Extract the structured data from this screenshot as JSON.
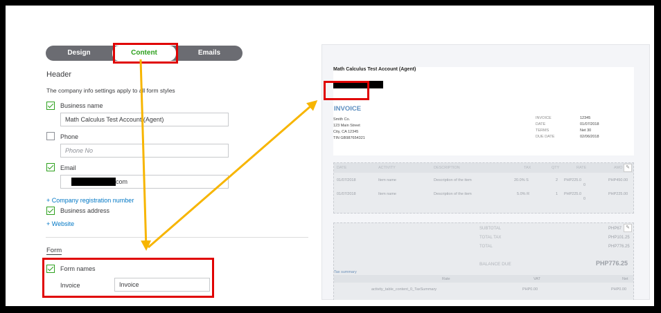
{
  "tabs": {
    "design": "Design",
    "content": "Content",
    "emails": "Emails"
  },
  "header": {
    "title": "Header",
    "hint": "The company info settings apply to all form styles",
    "business_name_label": "Business name",
    "business_name_value": "Math Calculus Test Account (Agent)",
    "phone_label": "Phone",
    "phone_placeholder": "Phone No",
    "email_label": "Email",
    "email_value_suffix": "com",
    "company_reg_link": "+ Company registration number",
    "business_address_label": "Business address",
    "website_link": "+ Website"
  },
  "form": {
    "title": "Form",
    "form_names_label": "Form names",
    "invoice_label": "Invoice",
    "invoice_value": "Invoice"
  },
  "preview": {
    "company": "Math Calculus Test Account (Agent)",
    "invoice_title": "INVOICE",
    "address_lines": [
      "Smith Co.",
      "123 Main Street",
      "City, CA 12345",
      "TIN GB987654321"
    ],
    "meta": [
      {
        "k": "INVOICE",
        "v": "12345"
      },
      {
        "k": "DATE",
        "v": "01/07/2018"
      },
      {
        "k": "TERMS",
        "v": "Net 30"
      },
      {
        "k": "DUE DATE",
        "v": "02/06/2018"
      }
    ],
    "columns": [
      "DATE",
      "ACTIVITY",
      "DESCRIPTION",
      "TAX",
      "QTY",
      "RATE",
      "AMO"
    ],
    "rows": [
      {
        "date": "01/07/2018",
        "activity": "Item name",
        "desc": "Description of the item",
        "tax": "20.0% S",
        "qty": "2",
        "rate": "PHP225.0",
        "rate2": "0",
        "amount": "PHP450.00"
      },
      {
        "date": "01/07/2018",
        "activity": "Item name",
        "desc": "Description of the item",
        "tax": "5.0% R",
        "qty": "1",
        "rate": "PHP225.0",
        "rate2": "0",
        "amount": "PHP225.00"
      }
    ],
    "subtotal_label": "SUBTOTAL",
    "subtotal_value": "PHP67",
    "total_tax_label": "TOTAL TAX",
    "total_tax_value": "PHP101.25",
    "total_label": "TOTAL",
    "total_value": "PHP776.25",
    "balance_label": "BALANCE DUE",
    "balance_value": "PHP776.25",
    "tax_summary_label": "Tax summary",
    "tax_cols": {
      "rate": "Rate",
      "vat": "VAT",
      "net": "Net"
    },
    "tax_row": {
      "name": "activity_table_content_0_TaxSummary",
      "vat": "PHP0.00",
      "net": "PHP0.00"
    }
  },
  "colors": {
    "annotation_red": "#e00000",
    "arrow_yellow": "#f7b500",
    "accent_green": "#2ca01c",
    "link_blue": "#0077c5"
  }
}
